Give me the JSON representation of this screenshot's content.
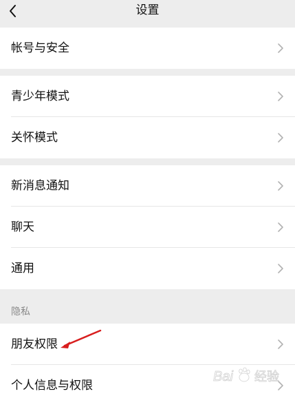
{
  "header": {
    "title": "设置"
  },
  "groups": [
    {
      "items": [
        {
          "label": "帐号与安全"
        }
      ]
    },
    {
      "items": [
        {
          "label": "青少年模式"
        },
        {
          "label": "关怀模式"
        }
      ]
    },
    {
      "items": [
        {
          "label": "新消息通知"
        },
        {
          "label": "聊天"
        },
        {
          "label": "通用"
        }
      ]
    },
    {
      "section_title": "隐私",
      "items": [
        {
          "label": "朋友权限"
        },
        {
          "label": "个人信息与权限"
        }
      ]
    }
  ],
  "annotation": {
    "arrow_color": "#d81e1e"
  },
  "watermark": {
    "text": "Baidu 经验"
  }
}
